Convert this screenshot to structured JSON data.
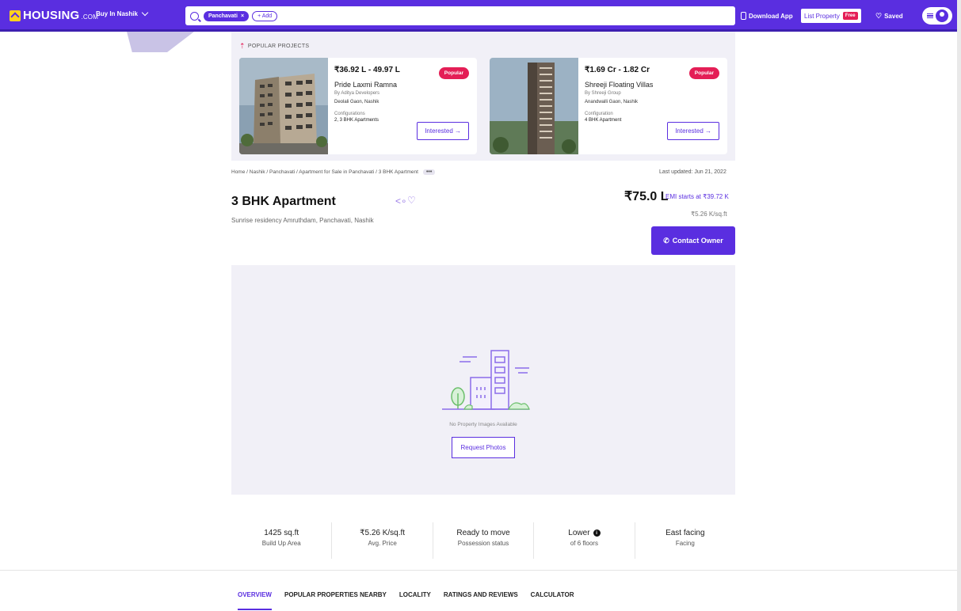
{
  "header": {
    "logo": "HOUSING",
    "logo_suffix": ".COM",
    "city_select": "Buy In Nashik",
    "search_chip": "Panchavati",
    "add_chip": "+ Add",
    "download_app": "Download App",
    "list_property": "List Property",
    "free_badge": "Free",
    "saved": "Saved"
  },
  "popular": {
    "title": "POPULAR PROJECTS",
    "cards": [
      {
        "price": "₹36.92 L - 49.97 L",
        "name": "Pride Laxmi Ramna",
        "developer": "By Aditya Developers",
        "location": "Deolali Gaon, Nashik",
        "config_label": "Configurations",
        "config": "2, 3 BHK Apartments",
        "badge": "Popular",
        "cta": "Interested →"
      },
      {
        "price": "₹1.69 Cr - 1.82 Cr",
        "name": "Shreeji Floating Villas",
        "developer": "By Shreeji Group",
        "location": "Anandwalli Gaon, Nashik",
        "config_label": "Configuration",
        "config": "4 BHK Apartment",
        "badge": "Popular",
        "cta": "Interested →"
      }
    ]
  },
  "breadcrumb": "Home / Nashik / Panchavati / Apartment for Sale in Panchavati / 3 BHK Apartment",
  "breadcrumb_more": "•••",
  "last_updated": "Last updated: Jun 21, 2022",
  "listing": {
    "title": "3 BHK Apartment",
    "subtitle": "Sunrise residency Amruthdam, Panchavati, Nashik",
    "price": "₹75.0 L",
    "emi": "EMI starts at ₹39.72 K",
    "per_sqft": "₹5.26 K/sq.ft",
    "contact": "Contact Owner"
  },
  "images": {
    "no_images": "No Property Images Available",
    "request": "Request Photos"
  },
  "highlights": [
    {
      "value": "1425 sq.ft",
      "label": "Build Up Area"
    },
    {
      "value": "₹5.26 K/sq.ft",
      "label": "Avg. Price"
    },
    {
      "value": "Ready to move",
      "label": "Possession status"
    },
    {
      "value": "Lower",
      "label": "of 6 floors"
    },
    {
      "value": "East facing",
      "label": "Facing"
    }
  ],
  "tabs": [
    "OVERVIEW",
    "POPULAR PROPERTIES NEARBY",
    "LOCALITY",
    "RATINGS AND REVIEWS",
    "CALCULATOR"
  ],
  "colors": {
    "brand": "#5a2ee0",
    "badge": "#e41e56"
  }
}
